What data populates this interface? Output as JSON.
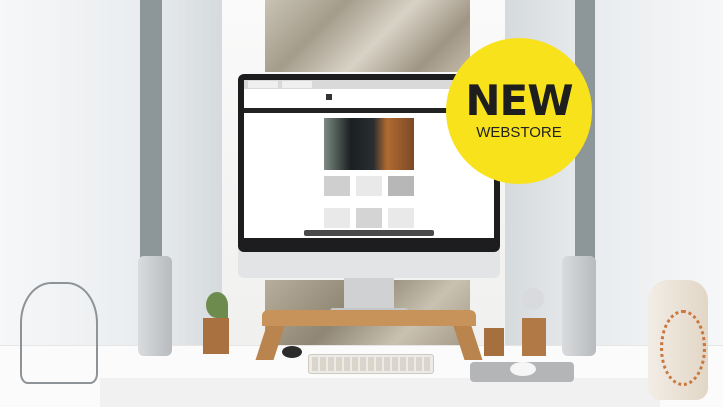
{
  "badge": {
    "headline": "NEW",
    "subline": "WEBSTORE",
    "color": "#f7e21b"
  },
  "scene": {
    "icons": [
      "monitor-icon",
      "speaker-icon",
      "keyboard-icon",
      "mouse-icon",
      "lamp-icon",
      "vase-icon",
      "plant-icon"
    ]
  }
}
